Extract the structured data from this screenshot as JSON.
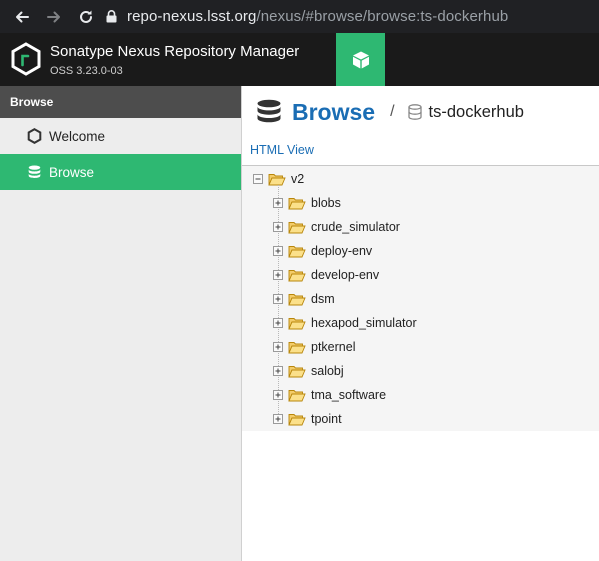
{
  "browser": {
    "url_host": "repo-nexus.lsst.org",
    "url_path": "/nexus/#browse/browse:ts-dockerhub"
  },
  "header": {
    "title": "Sonatype Nexus Repository Manager",
    "version": "OSS 3.23.0-03",
    "brand_color": "#2eb872"
  },
  "sidebar": {
    "title": "Browse",
    "items": [
      {
        "label": "Welcome",
        "icon": "hexagon-icon",
        "active": false
      },
      {
        "label": "Browse",
        "icon": "database-icon",
        "active": true
      }
    ]
  },
  "main": {
    "title": "Browse",
    "repository": "ts-dockerhub",
    "html_view_link": "HTML View",
    "accent_color": "#1a6db4",
    "tree": {
      "root": "v2",
      "children": [
        "blobs",
        "crude_simulator",
        "deploy-env",
        "develop-env",
        "dsm",
        "hexapod_simulator",
        "ptkernel",
        "salobj",
        "tma_software",
        "tpoint"
      ]
    }
  }
}
